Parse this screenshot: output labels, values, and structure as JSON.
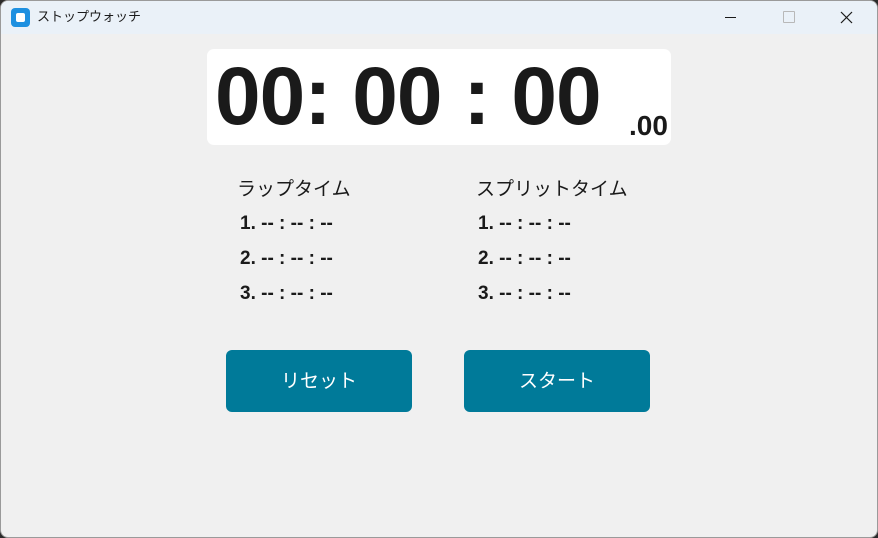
{
  "window": {
    "title": "ストップウォッチ",
    "accent": "#1e90e0"
  },
  "timer": {
    "main": "00: 00 : 00",
    "ms": ".00"
  },
  "lap": {
    "title": "ラップタイム",
    "rows": [
      "1. -- : -- : --",
      "2. -- : -- : --",
      "3. -- : -- : --"
    ]
  },
  "split": {
    "title": "スプリットタイム",
    "rows": [
      "1. -- : -- : --",
      "2. -- : -- : --",
      "3. -- : -- : --"
    ]
  },
  "buttons": {
    "reset_label": "リセット",
    "start_label": "スタート",
    "color": "#007a99"
  }
}
